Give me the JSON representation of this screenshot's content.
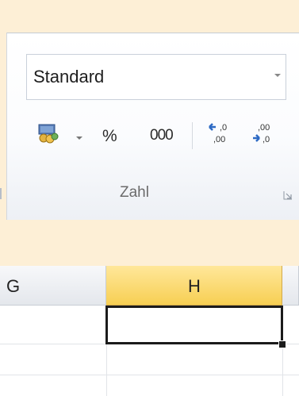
{
  "ribbon": {
    "number_format": {
      "value": "Standard"
    },
    "buttons": {
      "currency_icon": "currency-format-icon",
      "percent_label": "%",
      "thousands_label": "000",
      "increase_decimal_icon": "increase-decimal-icon",
      "decrease_decimal_icon": "decrease-decimal-icon"
    },
    "group_label": "Zahl",
    "launcher_icon": "dialog-launcher-icon"
  },
  "grid": {
    "columns": [
      {
        "label": "G"
      },
      {
        "label": "H"
      }
    ]
  },
  "colors": {
    "background": "#fdefd6",
    "selected_header": "#f7cf53",
    "active_cell_border": "#1b1b1b"
  }
}
